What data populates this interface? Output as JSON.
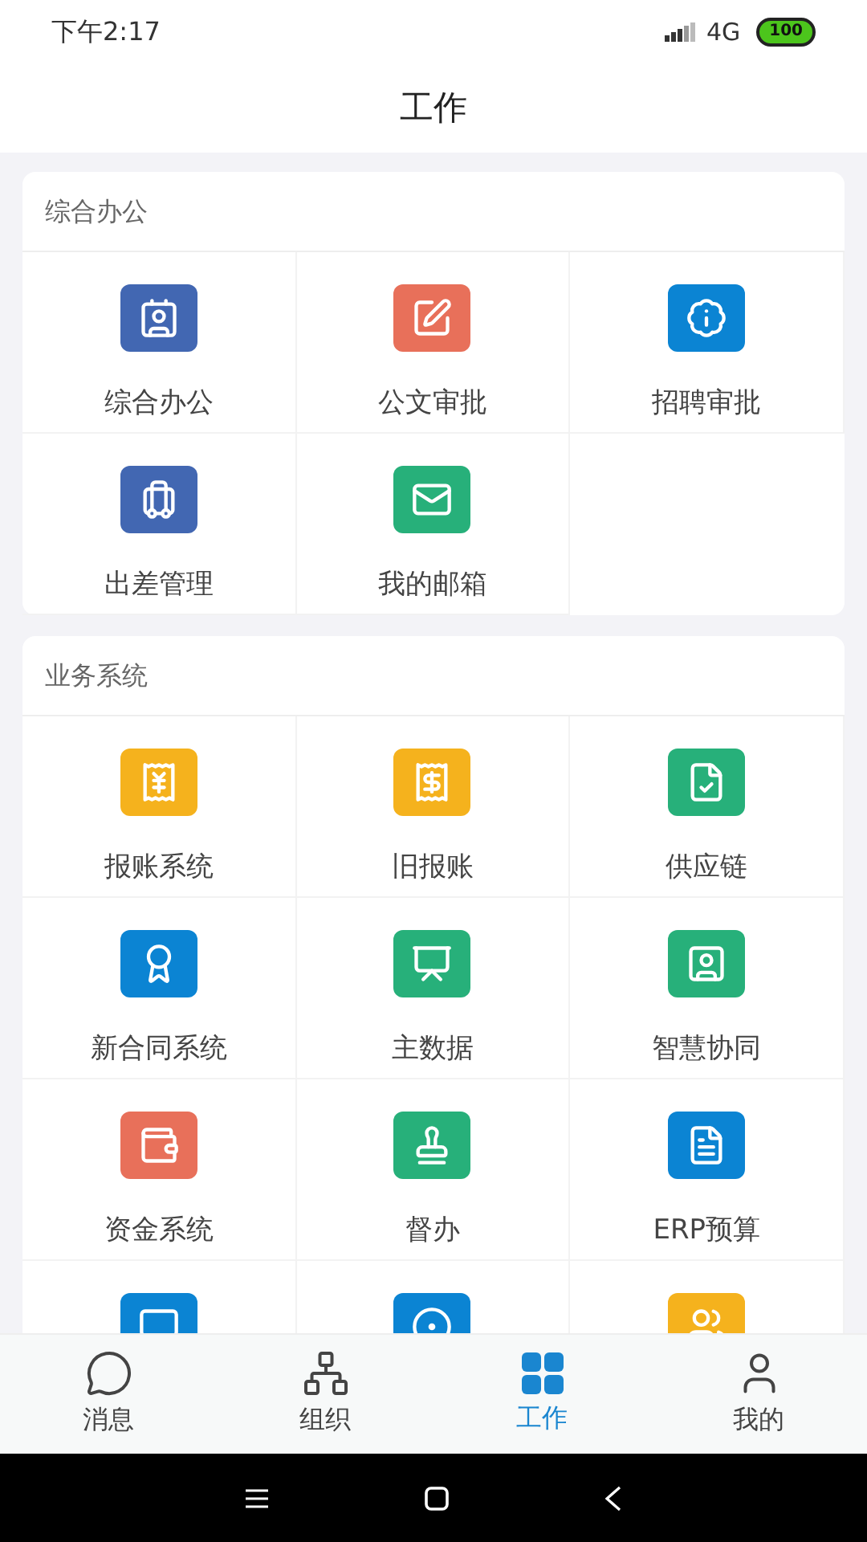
{
  "status_bar": {
    "time": "下午2:17",
    "network": "4G",
    "battery": "100"
  },
  "header": {
    "title": "工作"
  },
  "sections": [
    {
      "title": "综合办公",
      "items": [
        {
          "label": "综合办公",
          "kind": "contact",
          "color": "#4267b2"
        },
        {
          "label": "公文审批",
          "kind": "pen",
          "color": "#e8705a"
        },
        {
          "label": "招聘审批",
          "kind": "badge",
          "color": "#0b84d3"
        },
        {
          "label": "出差管理",
          "kind": "luggage",
          "color": "#4267b2"
        },
        {
          "label": "我的邮箱",
          "kind": "mail",
          "color": "#27b07a"
        }
      ]
    },
    {
      "title": "业务系统",
      "items": [
        {
          "label": "报账系统",
          "kind": "receipt-yen",
          "color": "#f5b21d"
        },
        {
          "label": "旧报账",
          "kind": "receipt",
          "color": "#f5b21d"
        },
        {
          "label": "供应链",
          "kind": "file-check",
          "color": "#27b07a"
        },
        {
          "label": "新合同系统",
          "kind": "award",
          "color": "#0b84d3"
        },
        {
          "label": "主数据",
          "kind": "presentation",
          "color": "#27b07a"
        },
        {
          "label": "智慧协同",
          "kind": "user-card",
          "color": "#27b07a"
        },
        {
          "label": "资金系统",
          "kind": "wallet",
          "color": "#e8705a"
        },
        {
          "label": "督办",
          "kind": "stamp",
          "color": "#27b07a"
        },
        {
          "label": "ERP预算",
          "kind": "file-text",
          "color": "#0b84d3"
        },
        {
          "kind": "monitor",
          "color": "#0b84d3"
        },
        {
          "kind": "circle-dot",
          "color": "#0b84d3"
        },
        {
          "kind": "users",
          "color": "#f5b21d"
        }
      ]
    }
  ],
  "tab_bar": [
    {
      "label": "消息",
      "kind": "chat",
      "selected": false
    },
    {
      "label": "组织",
      "kind": "org",
      "selected": false
    },
    {
      "label": "工作",
      "kind": "grid",
      "selected": true
    },
    {
      "label": "我的",
      "kind": "user",
      "selected": false
    }
  ]
}
